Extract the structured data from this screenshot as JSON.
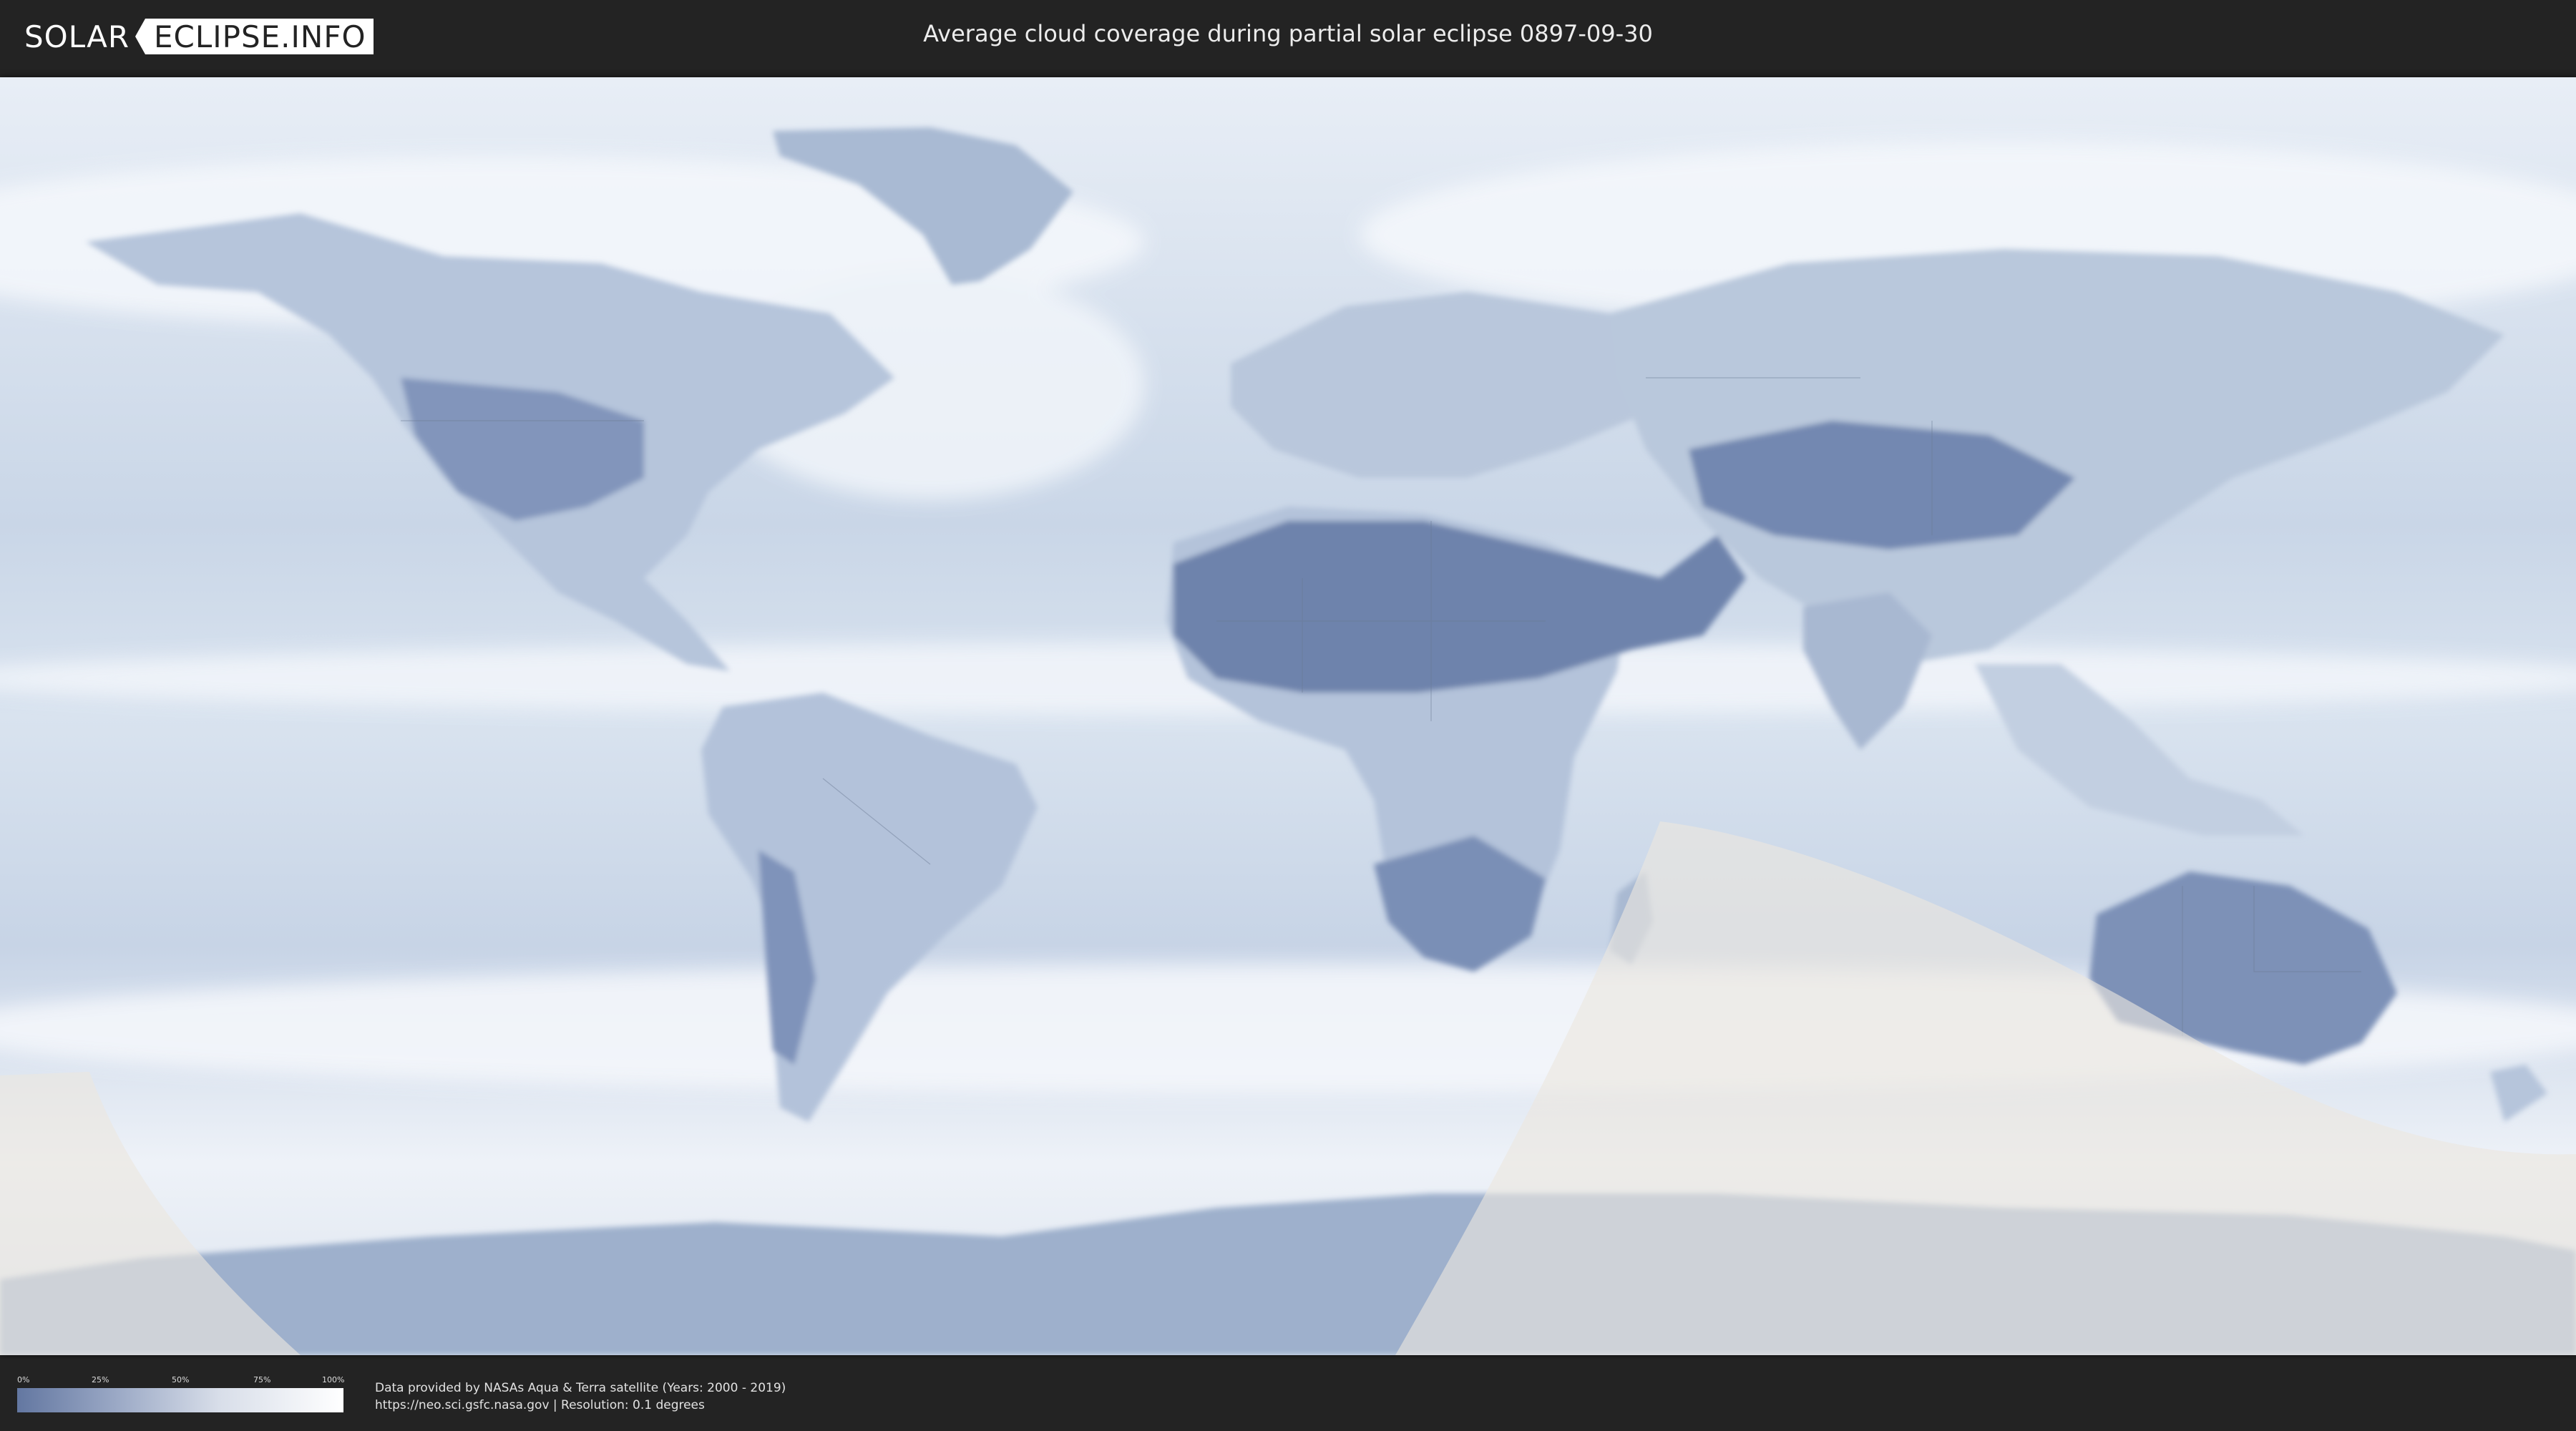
{
  "header": {
    "logo_left": "SOLAR",
    "logo_right": "ECLIPSE.INFO",
    "title": "Average cloud coverage during partial solar eclipse 0897-09-30"
  },
  "legend": {
    "ticks": [
      "0%",
      "25%",
      "50%",
      "75%",
      "100%"
    ],
    "color_low": "#6377a1",
    "color_high": "#ffffff"
  },
  "credits": {
    "line1": "Data provided by NASAs Aqua & Terra satellite (Years: 2000 - 2019)",
    "line2": "https://neo.sci.gsfc.nasa.gov | Resolution: 0.1 degrees"
  },
  "map": {
    "layer": "average cloud coverage",
    "overlay": "partial eclipse visibility zone",
    "colors": {
      "clear_sky": "#6d82aa",
      "cloud": "#f4f7fb",
      "eclipse_zone": "#e8e4dc"
    }
  }
}
